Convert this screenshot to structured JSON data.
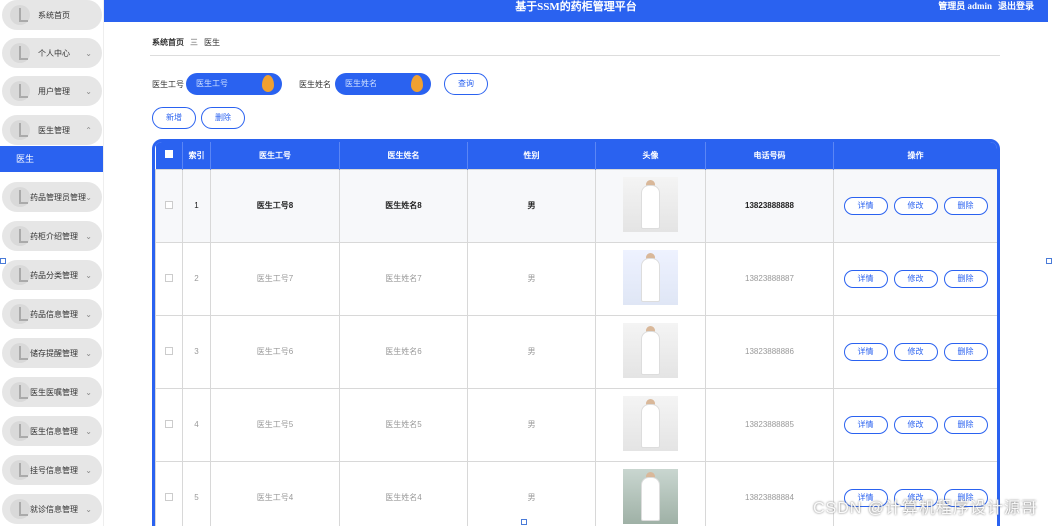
{
  "header": {
    "title": "基于SSM的药柜管理平台",
    "user": "管理员 admin",
    "logout": "退出登录"
  },
  "sidebar": {
    "items": [
      {
        "label": "系统首页",
        "arrow": ""
      },
      {
        "label": "个人中心",
        "arrow": "⌄"
      },
      {
        "label": "用户管理",
        "arrow": "⌄"
      },
      {
        "label": "医生管理",
        "arrow": "⌃"
      },
      {
        "label": "药品管理员管理",
        "arrow": "⌄"
      },
      {
        "label": "药柜介绍管理",
        "arrow": "⌄"
      },
      {
        "label": "药品分类管理",
        "arrow": "⌄"
      },
      {
        "label": "药品信息管理",
        "arrow": "⌄"
      },
      {
        "label": "储存提醒管理",
        "arrow": "⌄"
      },
      {
        "label": "医生医嘱管理",
        "arrow": "⌄"
      },
      {
        "label": "医生信息管理",
        "arrow": "⌄"
      },
      {
        "label": "挂号信息管理",
        "arrow": "⌄"
      },
      {
        "label": "就诊信息管理",
        "arrow": "⌄"
      }
    ],
    "active_sub": "医生"
  },
  "breadcrumb": {
    "home": "系统首页",
    "sep": "三",
    "current": "医生"
  },
  "search": {
    "id_label": "医生工号",
    "id_placeholder": "医生工号",
    "name_label": "医生姓名",
    "name_placeholder": "医生姓名",
    "query": "查询",
    "add": "新增",
    "delete": "删除"
  },
  "table": {
    "headers": [
      "",
      "索引",
      "医生工号",
      "医生姓名",
      "性别",
      "头像",
      "电话号码",
      "操作"
    ],
    "rows": [
      {
        "index": "1",
        "id": "医生工号8",
        "name": "医生姓名8",
        "gender": "男",
        "phone": "13823888888"
      },
      {
        "index": "2",
        "id": "医生工号7",
        "name": "医生姓名7",
        "gender": "男",
        "phone": "13823888887"
      },
      {
        "index": "3",
        "id": "医生工号6",
        "name": "医生姓名6",
        "gender": "男",
        "phone": "13823888886"
      },
      {
        "index": "4",
        "id": "医生工号5",
        "name": "医生姓名5",
        "gender": "男",
        "phone": "13823888885"
      },
      {
        "index": "5",
        "id": "医生工号4",
        "name": "医生姓名4",
        "gender": "男",
        "phone": "13823888884"
      }
    ],
    "ops": {
      "detail": "详情",
      "edit": "修改",
      "delete": "删除"
    }
  },
  "watermark": "CSDN @计算机程序设计源哥",
  "colors": {
    "primary": "#2a62f0",
    "accent": "#f0a030"
  }
}
